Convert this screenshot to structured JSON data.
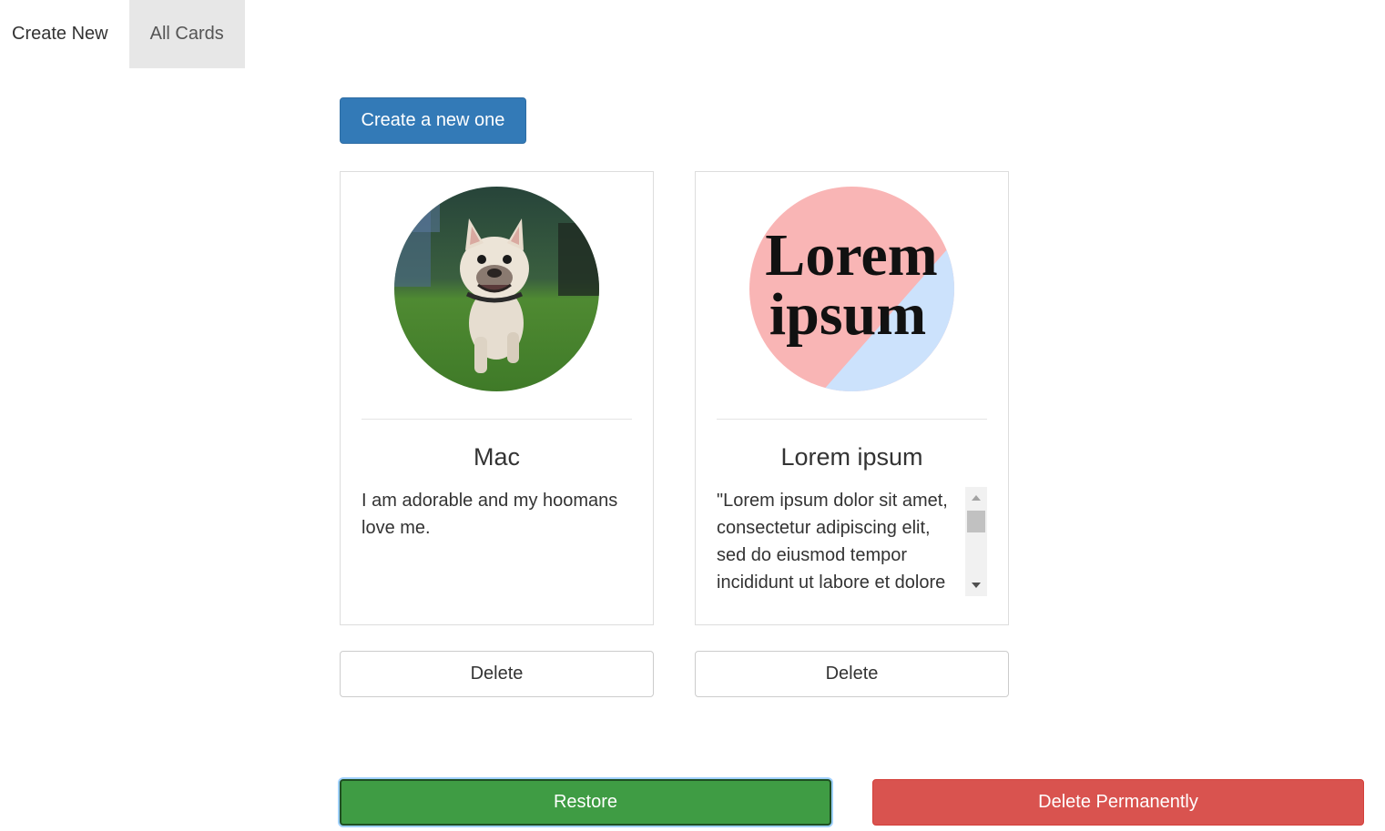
{
  "nav": {
    "tabs": [
      {
        "label": "Create New",
        "active": false
      },
      {
        "label": "All Cards",
        "active": true
      }
    ]
  },
  "toolbar": {
    "create_label": "Create a new one"
  },
  "cards": [
    {
      "title": "Mac",
      "text": "I am adorable and my hoomans love me.",
      "image": "french-bulldog-running-on-grass",
      "delete_label": "Delete"
    },
    {
      "title": "Lorem ipsum",
      "text": "\"Lorem ipsum dolor sit amet, consectetur adipiscing elit, sed do eiusmod tempor incididunt ut labore et dolore magna aliqua.",
      "image_text_line1": "Lorem",
      "image_text_line2": "ipsum",
      "delete_label": "Delete"
    }
  ],
  "footer": {
    "restore_label": "Restore",
    "delete_permanently_label": "Delete Permanently"
  },
  "colors": {
    "primary": "#337ab7",
    "success": "#3f9c44",
    "danger": "#d9534f",
    "tab_active_bg": "#e7e7e7"
  }
}
